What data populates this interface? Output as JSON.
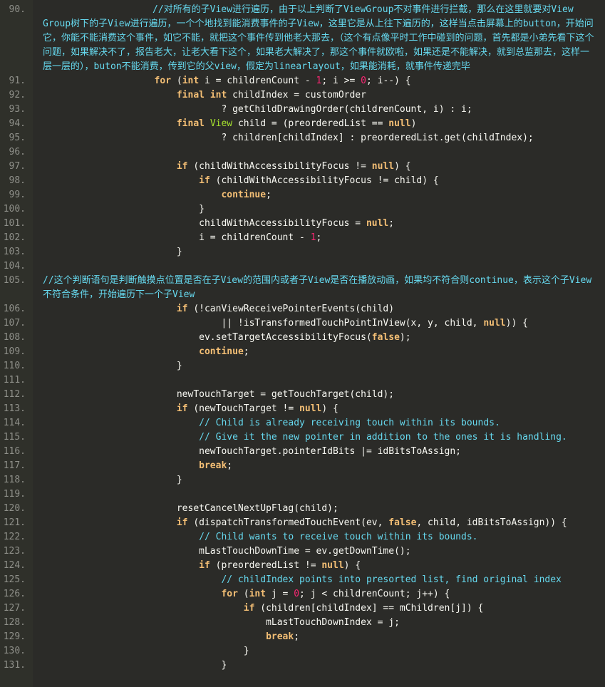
{
  "editor": {
    "line_numbers": [
      "90.",
      "91.",
      "92.",
      "93.",
      "94.",
      "95.",
      "96.",
      "97.",
      "98.",
      "99.",
      "100.",
      "101.",
      "102.",
      "103.",
      "104.",
      "105.",
      "106.",
      "107.",
      "108.",
      "109.",
      "110.",
      "111.",
      "112.",
      "113.",
      "114.",
      "115.",
      "116.",
      "117.",
      "118.",
      "119.",
      "120.",
      "121.",
      "122.",
      "123.",
      "124.",
      "125.",
      "126.",
      "127.",
      "128.",
      "129.",
      "130.",
      "131."
    ],
    "comment_90": "//对所有的子View进行遍历，由于以上判断了ViewGroup不对事件进行拦截，那么在这里就要对View Group树下的子View进行遍历，一个个地找到能消费事件的子View，这里它是从上往下遍历的，这样当点击屏幕上的button，开始问它，你能不能消费这个事件，如它不能，就把这个事件传到他老大那去，（这个有点像平时工作中碰到的问题，首先都是小弟先看下这个问题，如果解决不了，报告老大，让老大看下这个，如果老大解决了，那这个事件就欧啦，如果还是不能解决，就到总监那去，这样一层一层的），buton不能消费，传到它的父view，假定为linearlayout，如果能消耗，就事件传递完毕",
    "comment_105": "//这个判断语句是判断触摸点位置是否在子View的范围内或者子View是否在播放动画，如果均不符合则continue，表示这个子View不符合条件，开始遍历下一个子View",
    "code_lines": [
      "                    for (int i = childrenCount - 1; i >= 0; i--) {",
      "                        final int childIndex = customOrder",
      "                                ? getChildDrawingOrder(childrenCount, i) : i;",
      "                        final View child = (preorderedList == null)",
      "                                ? children[childIndex] : preorderedList.get(childIndex);",
      "",
      "                        if (childWithAccessibilityFocus != null) {",
      "                            if (childWithAccessibilityFocus != child) {",
      "                                continue;",
      "                            }",
      "                            childWithAccessibilityFocus = null;",
      "                            i = childrenCount - 1;",
      "                        }",
      "",
      "                        if (!canViewReceivePointerEvents(child)",
      "                                || !isTransformedTouchPointInView(x, y, child, null)) {",
      "                            ev.setTargetAccessibilityFocus(false);",
      "                            continue;",
      "                        }",
      "",
      "                        newTouchTarget = getTouchTarget(child);",
      "                        if (newTouchTarget != null) {",
      "                            // Child is already receiving touch within its bounds.",
      "                            // Give it the new pointer in addition to the ones it is handling.",
      "                            newTouchTarget.pointerIdBits |= idBitsToAssign;",
      "                            break;",
      "                        }",
      "",
      "                        resetCancelNextUpFlag(child);",
      "                        if (dispatchTransformedTouchEvent(ev, false, child, idBitsToAssign)) {",
      "                            // Child wants to receive touch within its bounds.",
      "                            mLastTouchDownTime = ev.getDownTime();",
      "                            if (preorderedList != null) {",
      "                                // childIndex points into presorted list, find original index",
      "                                for (int j = 0; j < childrenCount; j++) {",
      "                                    if (children[childIndex] == mChildren[j]) {",
      "                                        mLastTouchDownIndex = j;",
      "                                        break;",
      "                                    }",
      "                                }"
    ]
  }
}
